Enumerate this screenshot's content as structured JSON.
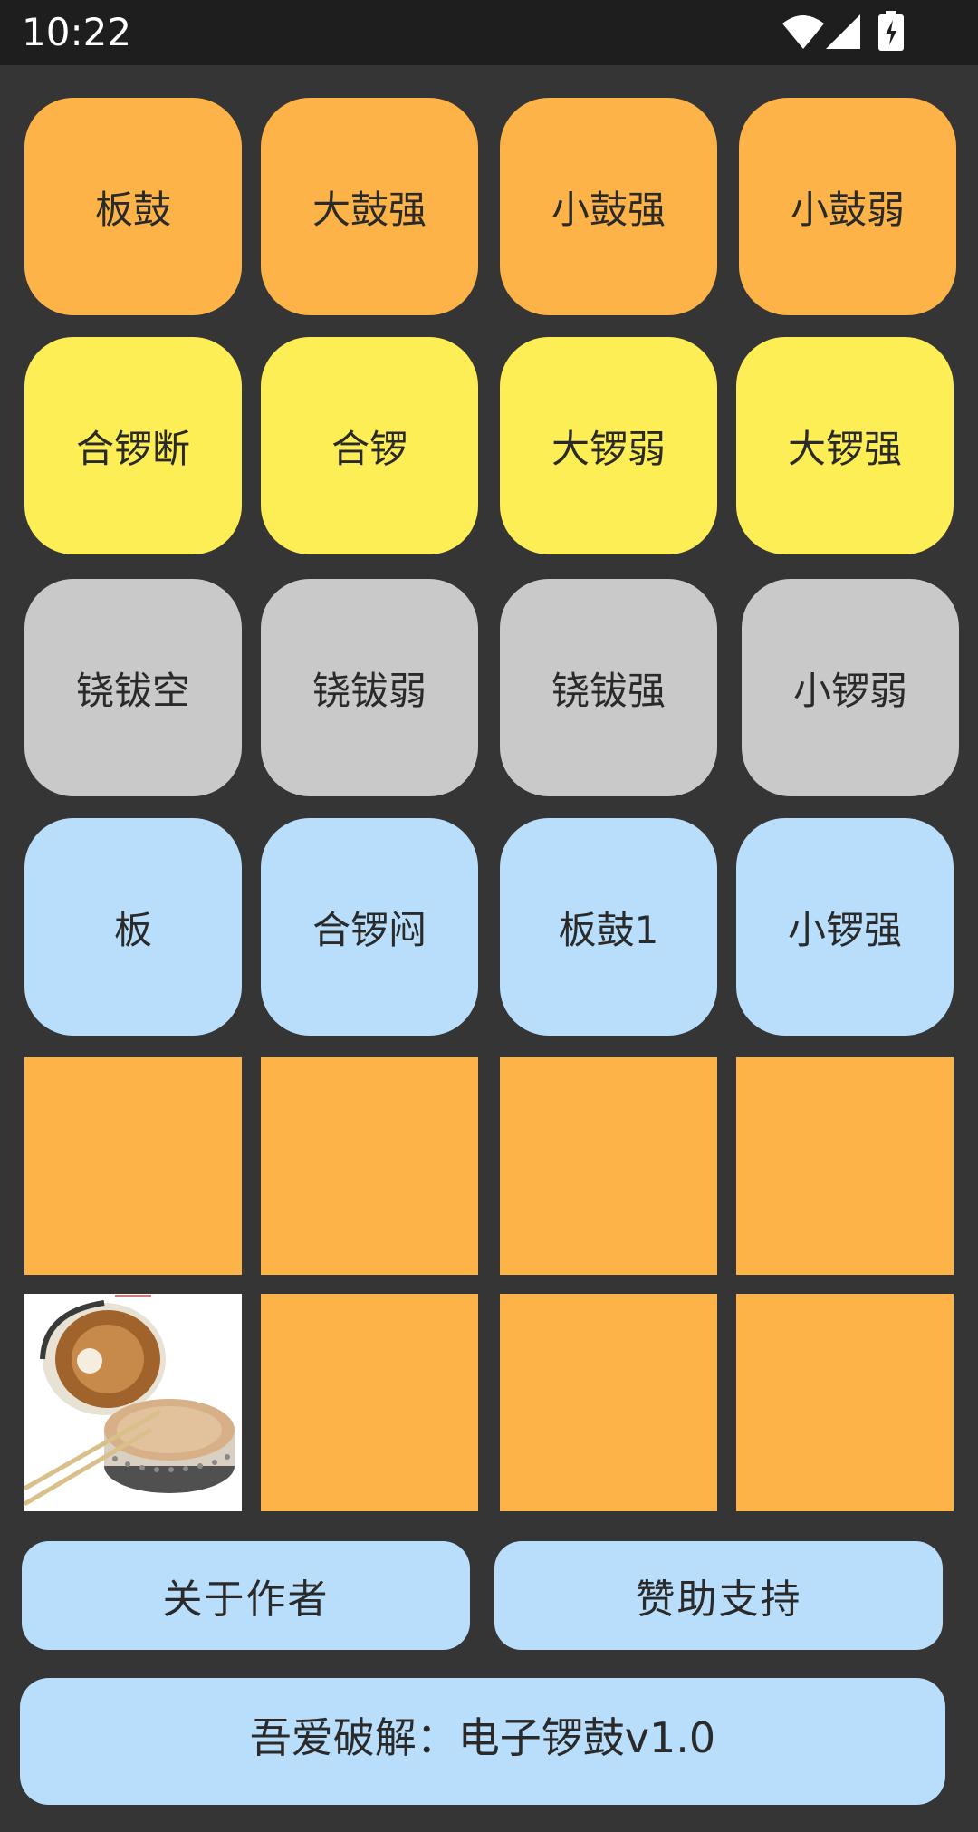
{
  "status_bar": {
    "time": "10:22",
    "icons": [
      "wifi-icon",
      "cell-signal-icon",
      "battery-charging-icon"
    ]
  },
  "pads": {
    "row1": [
      "板鼓",
      "大鼓强",
      "小鼓强",
      "小鼓弱"
    ],
    "row2": [
      "合锣断",
      "合锣",
      "大锣弱",
      "大锣强"
    ],
    "row3": [
      "铙钹空",
      "铙钹弱",
      "铙钹强",
      "小锣弱"
    ],
    "row4": [
      "板",
      "合锣闷",
      "板鼓1",
      "小锣强"
    ]
  },
  "colors": {
    "orange": "#FDB347",
    "yellow": "#FEEE55",
    "gray": "#C9C9C9",
    "blue": "#B8DEFB",
    "background": "#353535",
    "status_bar": "#1e1e1e"
  },
  "buttons": {
    "about_author": "关于作者",
    "sponsor_support": "赞助支持",
    "footer": "吾爱破解：电子锣鼓v1.0"
  }
}
